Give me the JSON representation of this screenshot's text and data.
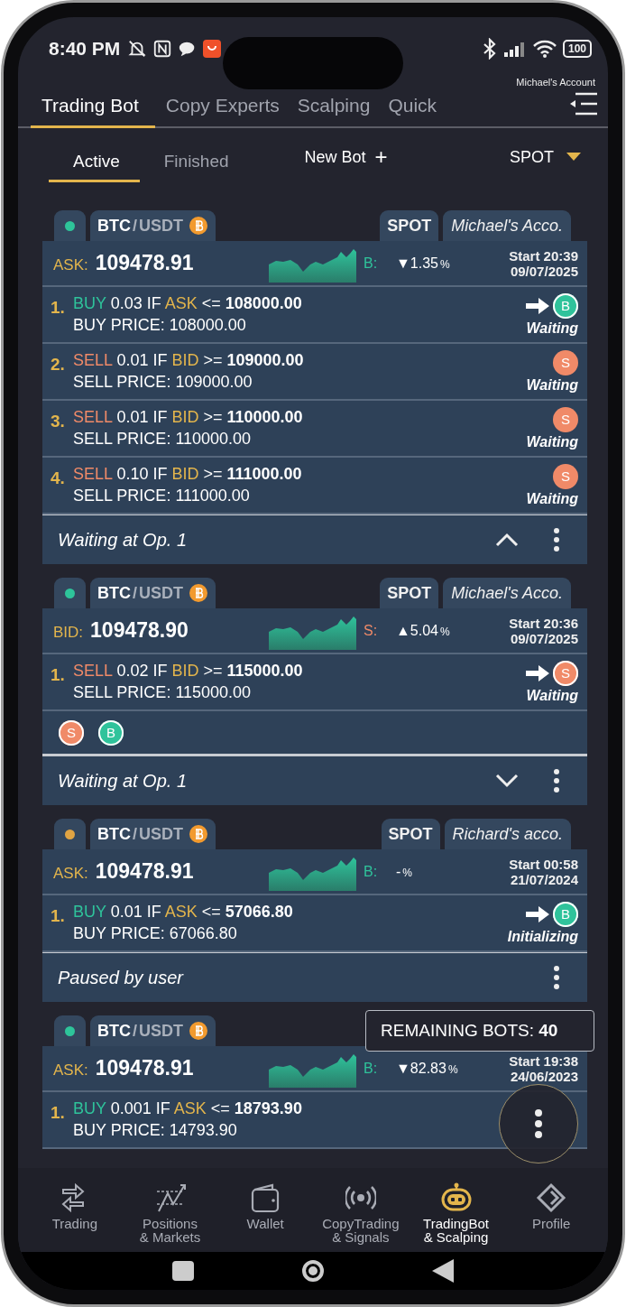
{
  "status_bar": {
    "time": "8:40 PM",
    "battery": "100"
  },
  "account": "Michael's Account",
  "top_tabs": [
    {
      "label": "Trading Bot",
      "selected": true
    },
    {
      "label": "Copy Experts",
      "selected": false
    },
    {
      "label": "Scalping",
      "selected": false
    },
    {
      "label": "Quick",
      "selected": false
    }
  ],
  "sub_tabs": [
    {
      "label": "Active",
      "selected": true
    },
    {
      "label": "Finished",
      "selected": false
    }
  ],
  "new_bot": {
    "label": "New Bot",
    "icon": "+"
  },
  "market_filter": {
    "label": "SPOT"
  },
  "bots": [
    {
      "color": "#2ec49a",
      "base": "BTC",
      "separator": "/",
      "quote": "USDT",
      "market": "SPOT",
      "account": "Michael's Acco.",
      "price_label": "ASK:",
      "price": "109478.91",
      "side_label": "B:",
      "kind": "buy",
      "change": "▼1.35",
      "change_unit": "%",
      "start": "Start 20:39",
      "date": "09/07/2025",
      "ops": [
        {
          "number": "1.",
          "kind": "buy",
          "side": "BUY",
          "qty": "0.03",
          "if": "IF",
          "field": "ASK",
          "operator": "<=",
          "target": "108000.00",
          "price_line": "BUY PRICE: 108000.00",
          "current": true,
          "badge": "B",
          "state": "Waiting"
        },
        {
          "number": "2.",
          "kind": "sell",
          "side": "SELL",
          "qty": "0.01",
          "if": "IF",
          "field": "BID",
          "operator": ">=",
          "target": "109000.00",
          "price_line": "SELL PRICE: 109000.00",
          "current": false,
          "badge": "S",
          "state": "Waiting"
        },
        {
          "number": "3.",
          "kind": "sell",
          "side": "SELL",
          "qty": "0.01",
          "if": "IF",
          "field": "BID",
          "operator": ">=",
          "target": "110000.00",
          "price_line": "SELL PRICE: 110000.00",
          "current": false,
          "badge": "S",
          "state": "Waiting"
        },
        {
          "number": "4.",
          "kind": "sell",
          "side": "SELL",
          "qty": "0.10",
          "if": "IF",
          "field": "BID",
          "operator": ">=",
          "target": "111000.00",
          "price_line": "SELL PRICE: 111000.00",
          "current": false,
          "badge": "S",
          "state": "Waiting"
        }
      ],
      "status": "Waiting at Op. 1",
      "expanded": true
    },
    {
      "color": "#2ec49a",
      "base": "BTC",
      "separator": "/",
      "quote": "USDT",
      "market": "SPOT",
      "account": "Michael's Acco.",
      "price_label": "BID:",
      "price": "109478.90",
      "side_label": "S:",
      "kind": "sell",
      "change": "▲5.04",
      "change_unit": "%",
      "start": "Start 20:36",
      "date": "09/07/2025",
      "ops": [
        {
          "number": "1.",
          "kind": "sell",
          "side": "SELL",
          "qty": "0.02",
          "if": "IF",
          "field": "BID",
          "operator": ">=",
          "target": "115000.00",
          "price_line": "SELL PRICE: 115000.00",
          "current": true,
          "badge": "S",
          "state": "Waiting"
        }
      ],
      "legend": [
        {
          "kind": "sell",
          "letter": "S"
        },
        {
          "kind": "buy",
          "letter": "B"
        }
      ],
      "status": "Waiting at Op. 1",
      "expanded": false
    },
    {
      "color": "#e0a443",
      "base": "BTC",
      "separator": "/",
      "quote": "USDT",
      "market": "SPOT",
      "account": "Richard's acco.",
      "price_label": "ASK:",
      "price": "109478.91",
      "side_label": "B:",
      "kind": "buy",
      "change": "-",
      "change_unit": "%",
      "start": "Start 00:58",
      "date": "21/07/2024",
      "ops": [
        {
          "number": "1.",
          "kind": "buy",
          "side": "BUY",
          "qty": "0.01",
          "if": "IF",
          "field": "ASK",
          "operator": "<=",
          "target": "57066.80",
          "price_line": "BUY PRICE: 67066.80",
          "current": true,
          "badge": "B",
          "state": "Initializing"
        }
      ],
      "status": "Paused by user"
    },
    {
      "color": "#2ec49a",
      "base": "BTC",
      "separator": "/",
      "quote": "USDT",
      "price_label": "ASK:",
      "price": "109478.91",
      "side_label": "B:",
      "kind": "buy",
      "change": "▼82.83",
      "change_unit": "%",
      "start": "Start 19:38",
      "date": "24/06/2023",
      "ops": [
        {
          "number": "1.",
          "kind": "buy",
          "side": "BUY",
          "qty": "0.001",
          "if": "IF",
          "field": "ASK",
          "operator": "<=",
          "target": "18793.90",
          "price_line": "BUY PRICE: 14793.90"
        }
      ]
    }
  ],
  "remaining": "REMAINING BOTS: **40**",
  "nav": [
    {
      "label": "Trading",
      "selected": false
    },
    {
      "label": "Positions\n& Markets",
      "selected": false
    },
    {
      "label": "Wallet",
      "selected": false
    },
    {
      "label": "CopyTrading\n& Signals",
      "selected": false
    },
    {
      "label": "TradingBot\n& Scalping",
      "selected": true
    },
    {
      "label": "Profile",
      "selected": false
    }
  ]
}
